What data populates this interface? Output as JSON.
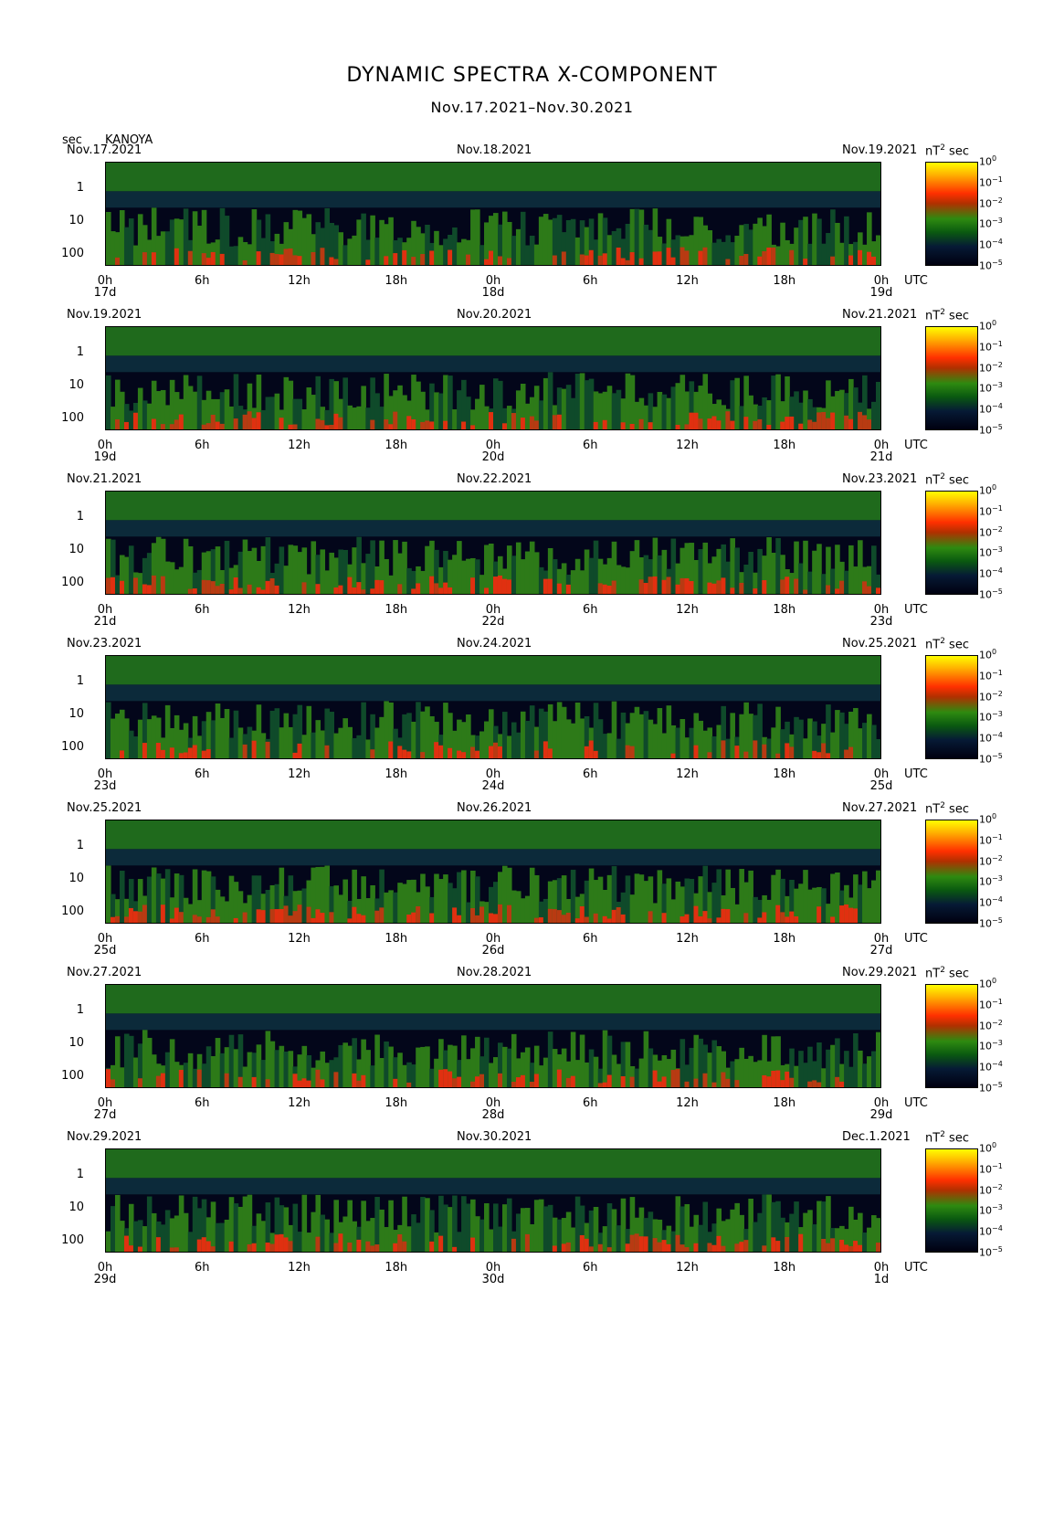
{
  "title": "DYNAMIC SPECTRA X-COMPONENT",
  "subtitle": "Nov.17.2021–Nov.30.2021",
  "y_unit": "sec",
  "station": "KANOYA",
  "time_zone": "UTC",
  "colorbar": {
    "unit_label": "nT",
    "unit_exp": "2",
    "unit_tail": "sec",
    "base": "10",
    "exponents": [
      "0",
      "−1",
      "−2",
      "−3",
      "−4",
      "−5"
    ],
    "colors": [
      "#ffff00",
      "#ff3000",
      "#2e8a10",
      "#061a35",
      "#000010"
    ]
  },
  "chart_data": {
    "type": "heatmap",
    "x_ticks": [
      "0h",
      "6h",
      "12h",
      "18h",
      "0h",
      "6h",
      "12h",
      "18h",
      "0h"
    ],
    "y_ticks": [
      "1",
      "10",
      "100"
    ],
    "y_scale": "log",
    "panels": [
      {
        "left_date": "Nov.17.2021",
        "mid_date": "Nov.18.2021",
        "right_date": "Nov.19.2021",
        "day_labels": [
          "17d",
          "18d",
          "19d"
        ]
      },
      {
        "left_date": "Nov.19.2021",
        "mid_date": "Nov.20.2021",
        "right_date": "Nov.21.2021",
        "day_labels": [
          "19d",
          "20d",
          "21d"
        ]
      },
      {
        "left_date": "Nov.21.2021",
        "mid_date": "Nov.22.2021",
        "right_date": "Nov.23.2021",
        "day_labels": [
          "21d",
          "22d",
          "23d"
        ]
      },
      {
        "left_date": "Nov.23.2021",
        "mid_date": "Nov.24.2021",
        "right_date": "Nov.25.2021",
        "day_labels": [
          "23d",
          "24d",
          "25d"
        ]
      },
      {
        "left_date": "Nov.25.2021",
        "mid_date": "Nov.26.2021",
        "right_date": "Nov.27.2021",
        "day_labels": [
          "25d",
          "26d",
          "27d"
        ]
      },
      {
        "left_date": "Nov.27.2021",
        "mid_date": "Nov.28.2021",
        "right_date": "Nov.29.2021",
        "day_labels": [
          "27d",
          "28d",
          "29d"
        ]
      },
      {
        "left_date": "Nov.29.2021",
        "mid_date": "Nov.30.2021",
        "right_date": "Dec.1.2021",
        "day_labels": [
          "29d",
          "30d",
          "1d"
        ]
      }
    ]
  }
}
